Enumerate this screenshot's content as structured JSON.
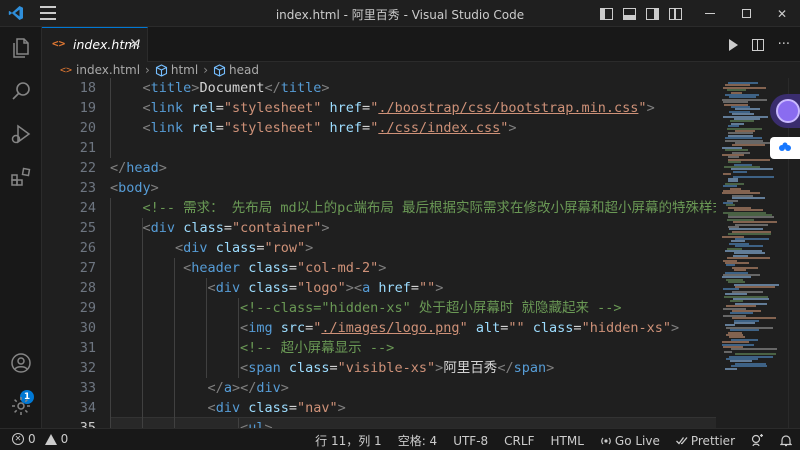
{
  "titlebar": {
    "title": "index.html - 阿里百秀 - Visual Studio Code"
  },
  "activity": {
    "account_badge": "1"
  },
  "tab": {
    "icon_text": "<>",
    "label": "index.html",
    "close_glyph": "×"
  },
  "breadcrumb": {
    "file_icon": "<>",
    "file": "index.html",
    "item1": "html",
    "item2": "head",
    "sep": "›"
  },
  "editor": {
    "line_numbers": [
      "18",
      "19",
      "20",
      "21",
      "22",
      "23",
      "24",
      "25",
      "26",
      "27",
      "28",
      "29",
      "30",
      "31",
      "32",
      "33",
      "34",
      "35"
    ],
    "cursor_line": "35",
    "code": {
      "l18": {
        "o1": "<",
        "tag": "title",
        "c1": ">",
        "text": "Document",
        "o2": "</",
        "tag2": "title",
        "c2": ">"
      },
      "l19": {
        "o": "<",
        "tag": "link",
        "a1": "rel",
        "eq1": "=",
        "v1": "\"stylesheet\"",
        "a2": "href",
        "eq2": "=",
        "q1": "\"",
        "v2": "./boostrap/css/bootstrap.min.css",
        "q2": "\"",
        "c": ">"
      },
      "l20": {
        "o": "<",
        "tag": "link",
        "a1": "rel",
        "eq1": "=",
        "v1": "\"stylesheet\"",
        "a2": "href",
        "eq2": "=",
        "q1": "\"",
        "v2": "./css/index.css",
        "q2": "\"",
        "c": ">"
      },
      "l22": {
        "o": "</",
        "tag": "head",
        "c": ">"
      },
      "l23": {
        "o": "<",
        "tag": "body",
        "c": ">"
      },
      "l24": {
        "comment": "<!-- 需求： 先布局 md以上的pc端布局 最后根据实际需求在修改小屏幕和超小屏幕的特殊样式"
      },
      "l25": {
        "o": "<",
        "tag": "div",
        "a": "class",
        "eq": "=",
        "v": "\"container\"",
        "c": ">"
      },
      "l26": {
        "o": "<",
        "tag": "div",
        "a": "class",
        "eq": "=",
        "v": "\"row\"",
        "c": ">"
      },
      "l27": {
        "o": "<",
        "tag": "header",
        "a": "class",
        "eq": "=",
        "v": "\"col-md-2\"",
        "c": ">"
      },
      "l28": {
        "o1": "<",
        "tag1": "div",
        "a1": "class",
        "eq1": "=",
        "v1": "\"logo\"",
        "c1": ">",
        "o2": "<",
        "tag2": "a",
        "a2": "href",
        "eq2": "=",
        "v2": "\"\"",
        "c2": ">"
      },
      "l29": {
        "comment": "<!--class=\"hidden-xs\" 处于超小屏幕时 就隐藏起来 -->"
      },
      "l30": {
        "o": "<",
        "tag": "img",
        "a1": "src",
        "eq1": "=",
        "q1": "\"",
        "v1": "./images/logo.png",
        "q2": "\"",
        "a2": "alt",
        "eq2": "=",
        "v2": "\"\"",
        "a3": "class",
        "eq3": "=",
        "v3": "\"hidden-xs\"",
        "c": ">"
      },
      "l31": {
        "comment": "<!-- 超小屏幕显示 -->"
      },
      "l32": {
        "o": "<",
        "tag": "span",
        "a": "class",
        "eq": "=",
        "v": "\"visible-xs\"",
        "c": ">",
        "text": "阿里百秀",
        "o2": "</",
        "tag2": "span",
        "c2": ">"
      },
      "l33": {
        "o1": "</",
        "tag1": "a",
        "c1": ">",
        "o2": "</",
        "tag2": "div",
        "c2": ">"
      },
      "l34": {
        "o": "<",
        "tag": "div",
        "a": "class",
        "eq": "=",
        "v": "\"nav\"",
        "c": ">"
      },
      "l35": {
        "o": "<",
        "tag": "ul",
        "c": ">"
      }
    }
  },
  "status": {
    "errors": "0",
    "warnings": "0",
    "position": "行 11，列 1",
    "spaces": "空格: 4",
    "encoding": "UTF-8",
    "eol": "CRLF",
    "language": "HTML",
    "golive": "Go Live",
    "prettier": "Prettier"
  },
  "colors": {
    "accent": "#0078d4",
    "tag": "#569cd6",
    "attr": "#9cdcfe",
    "string": "#ce9178",
    "comment": "#6a9955",
    "punct": "#808080"
  }
}
